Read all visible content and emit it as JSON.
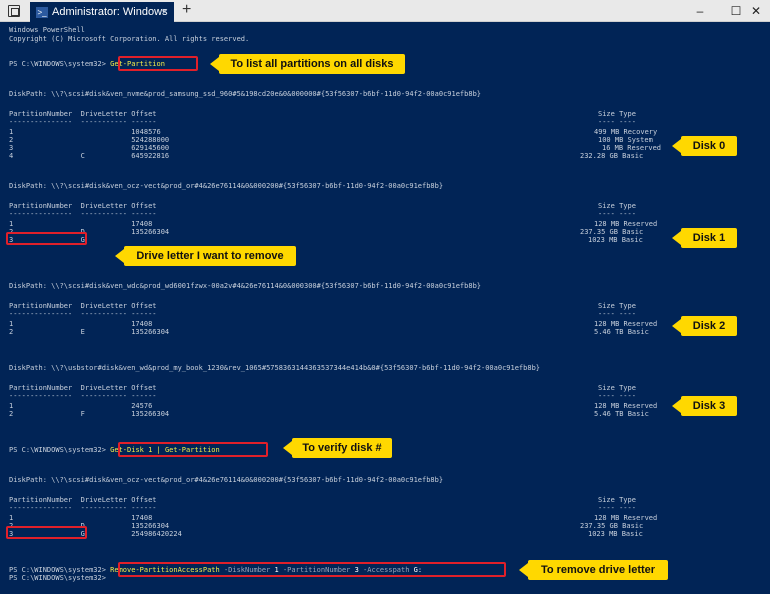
{
  "window": {
    "tab_title": "Administrator: Windows",
    "tab_close": "×",
    "new_tab": "+",
    "minimize": "–",
    "maximize": "☐",
    "close": "✕"
  },
  "console": {
    "header1": "Windows PowerShell",
    "header2": "Copyright (C) Microsoft Corporation. All rights reserved.",
    "prompt": "PS C:\\WINDOWS\\system32>",
    "cmd1": "Get-Partition",
    "cmd2": "Get-Disk 1 | Get-Partition",
    "cmd3_name": "Remove-PartitionAccessPath",
    "cmd3_p1": "-DiskNumber",
    "cmd3_v1": "1",
    "cmd3_p2": "-PartitionNumber",
    "cmd3_v2": "3",
    "cmd3_p3": "-Accesspath",
    "cmd3_v3": "G:",
    "col_left": "PartitionNumber  DriveLetter Offset",
    "col_right": "Size Type",
    "dash_left": "---------------  ----------- ------",
    "dash_right": "---- ----",
    "blocks": [
      {
        "diskpath": "DiskPath: \\\\?\\scsi#disk&ven_nvme&prod_samsung_ssd_960#5&198cd20e&0&000000#{53f56307-b6bf-11d0-94f2-00a0c91efb8b}",
        "rows": [
          {
            "left": "1                            1048576",
            "right": "499 MB Recovery"
          },
          {
            "left": "2                            524288000",
            "right": "100 MB System"
          },
          {
            "left": "3                            629145600",
            "right": "16 MB Reserved"
          },
          {
            "left": "4                C           645922816",
            "right": "232.28 GB Basic"
          }
        ]
      },
      {
        "diskpath": "DiskPath: \\\\?\\scsi#disk&ven_ocz-vect&prod_or#4&26e76114&0&000200#{53f56307-b6bf-11d0-94f2-00a0c91efb8b}",
        "rows": [
          {
            "left": "1                            17408",
            "right": "128 MB Reserved"
          },
          {
            "left": "2                D           135266304",
            "right": "237.35 GB Basic"
          },
          {
            "left": "3                G",
            "right": "1023 MB Basic"
          }
        ]
      },
      {
        "diskpath": "DiskPath: \\\\?\\scsi#disk&ven_wdc&prod_wd6001fzwx-00a2v#4&26e76114&0&000300#{53f56307-b6bf-11d0-94f2-00a0c91efb8b}",
        "rows": [
          {
            "left": "1                            17408",
            "right": "128 MB Reserved"
          },
          {
            "left": "2                E           135266304",
            "right": "5.46 TB Basic"
          }
        ]
      },
      {
        "diskpath": "DiskPath: \\\\?\\usbstor#disk&ven_wd&prod_my_book_1230&rev_1065#5758363144363537344e414b&0#{53f56307-b6bf-11d0-94f2-00a0c91efb8b}",
        "rows": [
          {
            "left": "1                            24576",
            "right": "128 MB Reserved"
          },
          {
            "left": "2                F           135266304",
            "right": "5.46 TB Basic"
          }
        ]
      },
      {
        "diskpath": "DiskPath: \\\\?\\scsi#disk&ven_ocz-vect&prod_or#4&26e76114&0&000200#{53f56307-b6bf-11d0-94f2-00a0c91efb8b}",
        "rows": [
          {
            "left": "1                            17408",
            "right": "128 MB Reserved"
          },
          {
            "left": "2                D           135266304",
            "right": "237.35 GB Basic"
          },
          {
            "left": "3                G           254986420224",
            "right": "1023 MB Basic"
          }
        ]
      }
    ]
  },
  "callouts": {
    "list_all": "To list all partitions on all disks",
    "disk0": "Disk 0",
    "disk1": "Disk 1",
    "drive_letter": "Drive letter I want to remove",
    "disk2": "Disk 2",
    "disk3": "Disk 3",
    "verify": "To verify disk #",
    "remove": "To remove drive letter"
  }
}
